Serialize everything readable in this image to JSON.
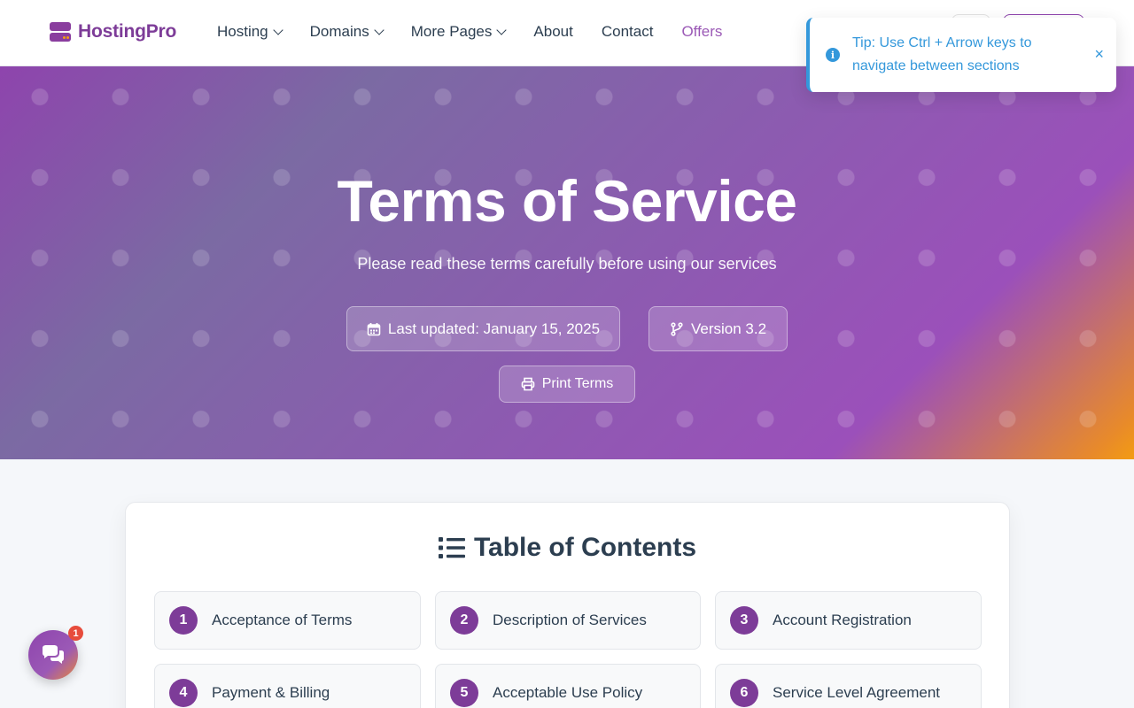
{
  "brand": {
    "name": "HostingPro",
    "color": "#7d3c98",
    "accent": "#f39c12"
  },
  "nav": {
    "items": [
      {
        "label": "Hosting",
        "dropdown": true
      },
      {
        "label": "Domains",
        "dropdown": true
      },
      {
        "label": "More Pages",
        "dropdown": true
      },
      {
        "label": "About",
        "dropdown": false
      },
      {
        "label": "Contact",
        "dropdown": false
      },
      {
        "label": "Offers",
        "dropdown": false,
        "highlight_color": "#9b59b6"
      }
    ]
  },
  "toast": {
    "icon": "info-icon",
    "message": "Tip: Use Ctrl + Arrow keys to navigate between sections",
    "close_symbol": "×",
    "color": "#3498db"
  },
  "hero": {
    "title": "Terms of Service",
    "subtitle": "Please read these terms carefully before using our services",
    "last_updated": "Last updated: January 15, 2025",
    "version": "Version 3.2",
    "print_label": "Print Terms"
  },
  "toc": {
    "title": "Table of Contents",
    "items": [
      {
        "number": "1",
        "label": "Acceptance of Terms"
      },
      {
        "number": "2",
        "label": "Description of Services"
      },
      {
        "number": "3",
        "label": "Account Registration"
      },
      {
        "number": "4",
        "label": "Payment & Billing"
      },
      {
        "number": "5",
        "label": "Acceptable Use Policy"
      },
      {
        "number": "6",
        "label": "Service Level Agreement"
      }
    ]
  },
  "chat": {
    "icon": "chat-icon",
    "badge_count": "1"
  }
}
